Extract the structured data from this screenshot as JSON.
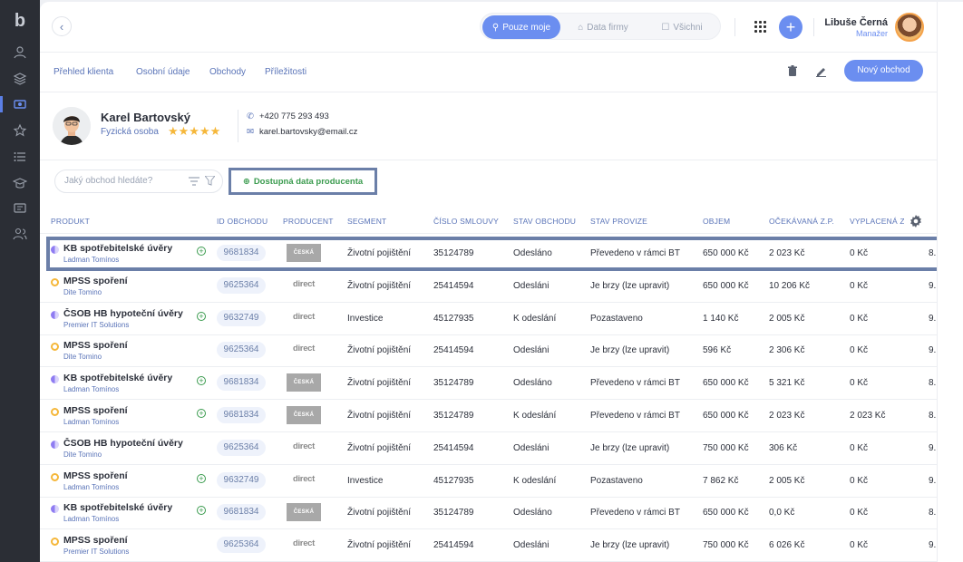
{
  "topbar": {
    "filters": [
      "Pouze moje",
      "Data firmy",
      "Všichni"
    ],
    "user_name": "Libuše Černá",
    "user_role": "Manažer"
  },
  "subnav": {
    "tabs": [
      "Přehled klienta",
      "Osobní údaje",
      "Obchody",
      "Příležitosti"
    ],
    "new_button": "Nový obchod"
  },
  "client": {
    "name": "Karel Bartovský",
    "type": "Fyzická osoba",
    "stars": "★★★★★",
    "phone": "+420 775 293 493",
    "email": "karel.bartovsky@email.cz"
  },
  "search": {
    "placeholder": "Jaký obchod hledáte?",
    "producer_button": "Dostupná data producenta"
  },
  "table": {
    "headers": [
      "Produkt",
      "ID obchodu",
      "Producent",
      "Segment",
      "Číslo smlouvy",
      "Stav obchodu",
      "Stav provize",
      "Objem",
      "Očekávaná z.p.",
      "Vyplacená z"
    ],
    "rows": [
      {
        "dot": "half",
        "name": "KB spotřebitelské úvěry",
        "sub": "Ladman Tomínos",
        "plus": true,
        "id": "9681834",
        "producer": "ČESKÁ",
        "segment": "Životní pojištění",
        "contract": "35124789",
        "status": "Odesláno",
        "commission": "Převedeno v rámci BT",
        "volume": "650 000 Kč",
        "expected": "2 023 Kč",
        "paid": "0 Kč",
        "extra": "8."
      },
      {
        "dot": "ring",
        "name": "MPSS spoření",
        "sub": "Dite Tomino",
        "plus": false,
        "id": "9625364",
        "producer": "direct",
        "segment": "Životní pojištění",
        "contract": "25414594",
        "status": "Odesláni",
        "commission": "Je brzy (lze upravit)",
        "volume": "650 000 Kč",
        "expected": "10 206 Kč",
        "paid": "0 Kč",
        "extra": "9."
      },
      {
        "dot": "half",
        "name": "ČSOB HB  hypoteční úvěry",
        "sub": "Premier IT Solutions",
        "plus": true,
        "id": "9632749",
        "producer": "direct",
        "segment": "Investice",
        "contract": "45127935",
        "status": "K odeslání",
        "commission": "Pozastaveno",
        "volume": "1 140 Kč",
        "expected": "2 005 Kč",
        "paid": "0 Kč",
        "extra": "9."
      },
      {
        "dot": "ring",
        "name": "MPSS spoření",
        "sub": "Dite Tomino",
        "plus": false,
        "id": "9625364",
        "producer": "direct",
        "segment": "Životní pojištění",
        "contract": "25414594",
        "status": "Odesláni",
        "commission": "Je brzy (lze upravit)",
        "volume": "596 Kč",
        "expected": "2 306 Kč",
        "paid": "0 Kč",
        "extra": "9."
      },
      {
        "dot": "half",
        "name": "KB spotřebitelské úvěry",
        "sub": "Ladman Tomínos",
        "plus": true,
        "id": "9681834",
        "producer": "ČESKÁ",
        "segment": "Životní pojištění",
        "contract": "35124789",
        "status": "Odesláno",
        "commission": "Převedeno v rámci BT",
        "volume": "650 000 Kč",
        "expected": "5 321 Kč",
        "paid": "0 Kč",
        "extra": "8."
      },
      {
        "dot": "ring",
        "name": "MPSS spoření",
        "sub": "Ladman Tomínos",
        "plus": true,
        "id": "9681834",
        "producer": "ČESKÁ",
        "segment": "Životní pojištění",
        "contract": "35124789",
        "status": "K odeslání",
        "commission": "Převedeno v rámci BT",
        "volume": "650 000 Kč",
        "expected": "2 023 Kč",
        "paid": "2 023 Kč",
        "extra": "8."
      },
      {
        "dot": "half",
        "name": "ČSOB HB  hypoteční úvěry",
        "sub": "Dite Tomino",
        "plus": false,
        "id": "9625364",
        "producer": "direct",
        "segment": "Životní pojištění",
        "contract": "25414594",
        "status": "Odesláni",
        "commission": "Je brzy (lze upravit)",
        "volume": "750 000 Kč",
        "expected": "306 Kč",
        "paid": "0 Kč",
        "extra": "9."
      },
      {
        "dot": "ring",
        "name": "MPSS spoření",
        "sub": "Ladman Tomínos",
        "plus": true,
        "id": "9632749",
        "producer": "direct",
        "segment": "Investice",
        "contract": "45127935",
        "status": "K odeslání",
        "commission": "Pozastaveno",
        "volume": "7 862 Kč",
        "expected": "2 005 Kč",
        "paid": "0 Kč",
        "extra": "9."
      },
      {
        "dot": "half",
        "name": "KB spotřebitelské úvěry",
        "sub": "Ladman Tomínos",
        "plus": true,
        "id": "9681834",
        "producer": "ČESKÁ",
        "segment": "Životní pojištění",
        "contract": "35124789",
        "status": "Odesláno",
        "commission": "Převedeno v rámci BT",
        "volume": "650 000 Kč",
        "expected": "0,0 Kč",
        "paid": "0 Kč",
        "extra": "8."
      },
      {
        "dot": "ring",
        "name": "MPSS spoření",
        "sub": "Premier IT Solutions",
        "plus": false,
        "id": "9625364",
        "producer": "direct",
        "segment": "Životní pojištění",
        "contract": "25414594",
        "status": "Odesláni",
        "commission": "Je brzy (lze upravit)",
        "volume": "750 000 Kč",
        "expected": "6 026 Kč",
        "paid": "0 Kč",
        "extra": "9."
      }
    ]
  },
  "colors": {
    "accent": "#6b8ef0",
    "label_blue": "#5a74b8",
    "green": "#3a9b4e",
    "star": "#f5b73a"
  }
}
